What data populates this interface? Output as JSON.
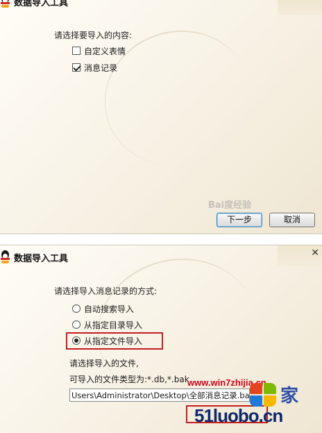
{
  "dialog1": {
    "title": "数据导入工具",
    "prompt": "请选择要导入的内容:",
    "options": [
      {
        "label": "自定义表情",
        "checked": false
      },
      {
        "label": "消息记录",
        "checked": true
      }
    ],
    "watermark": "Bai度经验",
    "buttons": {
      "next": "下一步",
      "cancel": "取消"
    }
  },
  "dialog2": {
    "title": "数据导入工具",
    "close": "✕",
    "prompt": "请选择导入消息记录的方式:",
    "options": [
      {
        "label": "自动搜索导入",
        "selected": false
      },
      {
        "label": "从指定目录导入",
        "selected": false
      },
      {
        "label": "从指定文件导入",
        "selected": true
      }
    ],
    "file_prompt": "请选择导入的文件,",
    "file_types": "可导入的文件类型为:*.db,*.bak",
    "path_value": "Users\\Administrator\\Desktop\\全部消息记录.bak"
  },
  "watermarks": {
    "url": "www.win7zhijia.cn",
    "brand": "51luobo.cn",
    "side_char": "家"
  },
  "colors": {
    "highlight": "#c41d1d",
    "watermark_red": "#d0021b",
    "watermark_blue": "#0e2a6b"
  }
}
